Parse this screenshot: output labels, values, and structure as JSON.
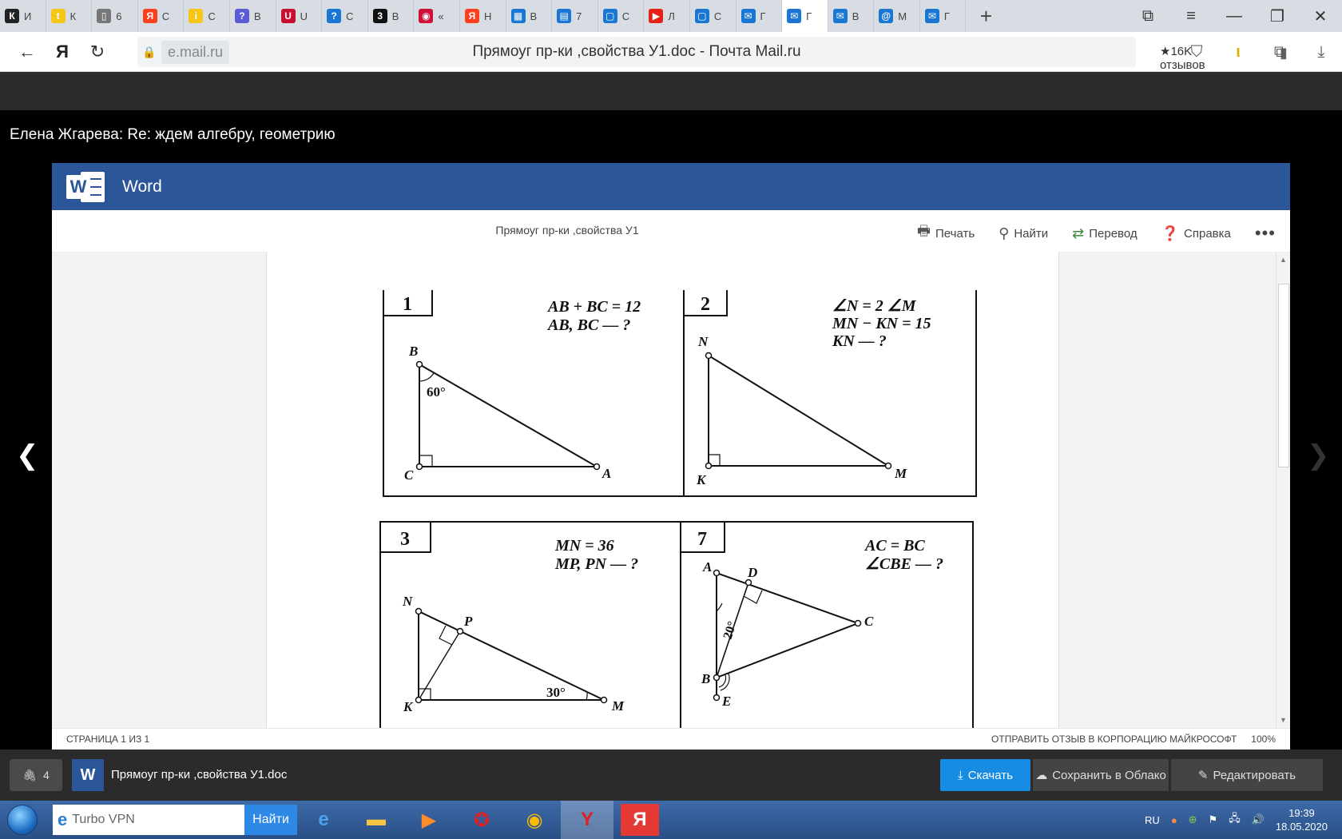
{
  "browser": {
    "tabs": [
      {
        "glyph": "К",
        "label": "И",
        "color": "#222"
      },
      {
        "glyph": "t",
        "label": "К",
        "color": "#f5c518"
      },
      {
        "glyph": "▯",
        "label": "6",
        "color": "#777"
      },
      {
        "glyph": "Я",
        "label": "С",
        "color": "#fc3f1d"
      },
      {
        "glyph": "i",
        "label": "С",
        "color": "#f5c518"
      },
      {
        "glyph": "?",
        "label": "В",
        "color": "#5b5bd6"
      },
      {
        "glyph": "U",
        "label": "U",
        "color": "#c8102e"
      },
      {
        "glyph": "?",
        "label": "С",
        "color": "#1976d2"
      },
      {
        "glyph": "3",
        "label": "В",
        "color": "#111"
      },
      {
        "glyph": "◉",
        "label": "«",
        "color": "#d0103a"
      },
      {
        "glyph": "Я",
        "label": "Н",
        "color": "#fc3f1d"
      },
      {
        "glyph": "▦",
        "label": "В",
        "color": "#1976d2"
      },
      {
        "glyph": "▤",
        "label": "7",
        "color": "#1976d2"
      },
      {
        "glyph": "▢",
        "label": "С",
        "color": "#1976d2"
      },
      {
        "glyph": "▶",
        "label": "Л",
        "color": "#e62117"
      },
      {
        "glyph": "▢",
        "label": "С",
        "color": "#1976d2"
      },
      {
        "glyph": "✉",
        "label": "Г",
        "color": "#1976d2"
      },
      {
        "glyph": "✉",
        "label": "Г",
        "color": "#1976d2",
        "active": true
      },
      {
        "glyph": "✉",
        "label": "В",
        "color": "#1976d2"
      },
      {
        "glyph": "@",
        "label": "М",
        "color": "#1976d2"
      },
      {
        "glyph": "✉",
        "label": "Г",
        "color": "#1976d2"
      }
    ],
    "domain": "e.mail.ru",
    "title": "Прямоуг пр-ки ,свойства У1.doc - Почта Mail.ru",
    "reviews": "★16K отзывов"
  },
  "mail": {
    "subject": "Елена Жгарева: Re: ждем алгебру, геометрию"
  },
  "word": {
    "app_name": "Word",
    "doc_title": "Прямоуг пр-ки ,свойства У1",
    "commands": {
      "print": "Печать",
      "find": "Найти",
      "translate": "Перевод",
      "help": "Справка"
    },
    "status_page": "СТРАНИЦА 1 ИЗ 1",
    "feedback": "ОТПРАВИТЬ ОТЗЫВ В КОРПОРАЦИЮ МАЙКРОСОФТ",
    "zoom": "100%"
  },
  "problems": [
    {
      "number": "1",
      "conditions": [
        "AB + BC = 12",
        "AB, BC — ?"
      ],
      "angle": "60°",
      "points": {
        "B": "B",
        "C": "C",
        "A": "A"
      }
    },
    {
      "number": "2",
      "conditions": [
        "∠N = 2 ∠M",
        "MN − KN = 15",
        "KN — ?"
      ],
      "points": {
        "N": "N",
        "K": "K",
        "M": "M"
      }
    },
    {
      "number": "3",
      "conditions": [
        "MN = 36",
        "MP, PN — ?"
      ],
      "angle": "30°",
      "points": {
        "N": "N",
        "P": "P",
        "K": "K",
        "M": "M"
      }
    },
    {
      "number": "7",
      "conditions": [
        "AC = BC",
        "∠CBE — ?"
      ],
      "angle": "20°",
      "points": {
        "A": "A",
        "D": "D",
        "C": "C",
        "B": "B",
        "E": "E"
      }
    }
  ],
  "attachments": {
    "count": "4",
    "file_name": "Прямоуг пр-ки ,свойства У1.doc",
    "download": "Скачать",
    "save_cloud": "Сохранить в Облако",
    "edit": "Редактировать"
  },
  "taskbar": {
    "search_value": "Turbo VPN",
    "search_button": "Найти",
    "lang": "RU",
    "time": "19:39",
    "date": "18.05.2020"
  }
}
